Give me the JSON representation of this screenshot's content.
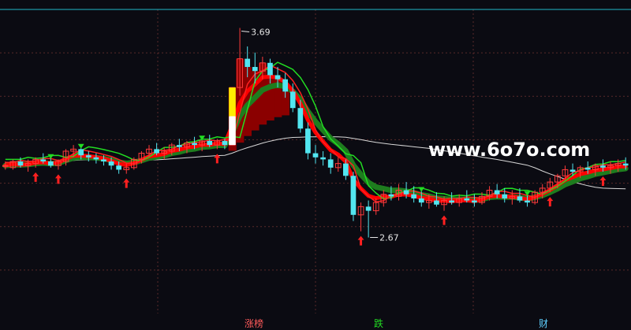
{
  "chart_data": {
    "type": "candlestick",
    "x": [
      1,
      2,
      3,
      4,
      5,
      6,
      7,
      8,
      9,
      10,
      11,
      12,
      13,
      14,
      15,
      16,
      17,
      18,
      19,
      20,
      21,
      22,
      23,
      24,
      25,
      26,
      27,
      28,
      29,
      30,
      31,
      32,
      33,
      34,
      35,
      36,
      37,
      38,
      39,
      40,
      41,
      42,
      43,
      44,
      45,
      46,
      47,
      48,
      49,
      50,
      51,
      52,
      53,
      54,
      55,
      56,
      57,
      58,
      59,
      60,
      61,
      62,
      63,
      64,
      65,
      66,
      67,
      68,
      69,
      70,
      71,
      72,
      73,
      74,
      75,
      76,
      77,
      78,
      79,
      80,
      81,
      82,
      83
    ],
    "ohlc": [
      [
        3.02,
        3.04,
        3.0,
        3.02
      ],
      [
        3.01,
        3.05,
        3.0,
        3.04
      ],
      [
        3.04,
        3.06,
        3.01,
        3.02
      ],
      [
        3.02,
        3.05,
        2.99,
        3.03
      ],
      [
        3.03,
        3.06,
        3.01,
        3.05
      ],
      [
        3.05,
        3.08,
        3.03,
        3.04
      ],
      [
        3.04,
        3.06,
        3.01,
        3.02
      ],
      [
        3.02,
        3.05,
        3.0,
        3.04
      ],
      [
        3.04,
        3.1,
        3.02,
        3.09
      ],
      [
        3.09,
        3.12,
        3.06,
        3.1
      ],
      [
        3.1,
        3.11,
        3.05,
        3.07
      ],
      [
        3.07,
        3.09,
        3.04,
        3.06
      ],
      [
        3.06,
        3.08,
        3.03,
        3.05
      ],
      [
        3.05,
        3.07,
        3.02,
        3.04
      ],
      [
        3.04,
        3.06,
        3.0,
        3.02
      ],
      [
        3.02,
        3.04,
        2.98,
        3.0
      ],
      [
        3.0,
        3.03,
        2.98,
        3.01
      ],
      [
        3.01,
        3.06,
        3.0,
        3.05
      ],
      [
        3.05,
        3.09,
        3.03,
        3.08
      ],
      [
        3.08,
        3.12,
        3.06,
        3.1
      ],
      [
        3.1,
        3.13,
        3.07,
        3.08
      ],
      [
        3.08,
        3.11,
        3.05,
        3.09
      ],
      [
        3.09,
        3.13,
        3.07,
        3.12
      ],
      [
        3.12,
        3.15,
        3.09,
        3.11
      ],
      [
        3.11,
        3.14,
        3.08,
        3.13
      ],
      [
        3.13,
        3.16,
        3.1,
        3.12
      ],
      [
        3.12,
        3.15,
        3.09,
        3.14
      ],
      [
        3.14,
        3.17,
        3.11,
        3.12
      ],
      [
        3.12,
        3.15,
        3.1,
        3.14
      ],
      [
        3.14,
        3.15,
        3.1,
        3.12
      ],
      [
        3.12,
        3.4,
        3.12,
        3.4
      ],
      [
        3.4,
        3.69,
        3.36,
        3.54
      ],
      [
        3.54,
        3.6,
        3.45,
        3.5
      ],
      [
        3.5,
        3.57,
        3.42,
        3.48
      ],
      [
        3.48,
        3.55,
        3.44,
        3.52
      ],
      [
        3.52,
        3.54,
        3.42,
        3.46
      ],
      [
        3.46,
        3.5,
        3.4,
        3.44
      ],
      [
        3.44,
        3.47,
        3.35,
        3.38
      ],
      [
        3.38,
        3.42,
        3.28,
        3.3
      ],
      [
        3.3,
        3.34,
        3.18,
        3.2
      ],
      [
        3.2,
        3.23,
        3.05,
        3.08
      ],
      [
        3.08,
        3.12,
        3.03,
        3.06
      ],
      [
        3.06,
        3.09,
        3.02,
        3.05
      ],
      [
        3.05,
        3.08,
        2.98,
        3.01
      ],
      [
        3.01,
        3.06,
        2.99,
        3.03
      ],
      [
        3.03,
        3.05,
        2.95,
        2.97
      ],
      [
        2.97,
        2.99,
        2.75,
        2.78
      ],
      [
        2.78,
        2.84,
        2.7,
        2.82
      ],
      [
        2.82,
        2.85,
        2.67,
        2.8
      ],
      [
        2.8,
        2.86,
        2.78,
        2.84
      ],
      [
        2.84,
        2.9,
        2.82,
        2.88
      ],
      [
        2.88,
        2.92,
        2.85,
        2.87
      ],
      [
        2.87,
        2.93,
        2.85,
        2.9
      ],
      [
        2.9,
        2.94,
        2.86,
        2.88
      ],
      [
        2.88,
        2.92,
        2.84,
        2.86
      ],
      [
        2.86,
        2.9,
        2.82,
        2.84
      ],
      [
        2.84,
        2.88,
        2.81,
        2.85
      ],
      [
        2.85,
        2.89,
        2.82,
        2.83
      ],
      [
        2.83,
        2.87,
        2.8,
        2.85
      ],
      [
        2.85,
        2.89,
        2.83,
        2.84
      ],
      [
        2.84,
        2.88,
        2.82,
        2.86
      ],
      [
        2.86,
        2.9,
        2.84,
        2.85
      ],
      [
        2.85,
        2.88,
        2.82,
        2.84
      ],
      [
        2.84,
        2.89,
        2.83,
        2.87
      ],
      [
        2.87,
        2.92,
        2.85,
        2.9
      ],
      [
        2.9,
        2.93,
        2.86,
        2.88
      ],
      [
        2.88,
        2.91,
        2.84,
        2.86
      ],
      [
        2.86,
        2.9,
        2.83,
        2.87
      ],
      [
        2.87,
        2.91,
        2.84,
        2.85
      ],
      [
        2.85,
        2.88,
        2.82,
        2.84
      ],
      [
        2.84,
        2.9,
        2.83,
        2.89
      ],
      [
        2.89,
        2.93,
        2.86,
        2.91
      ],
      [
        2.91,
        2.96,
        2.89,
        2.94
      ],
      [
        2.94,
        2.98,
        2.91,
        2.97
      ],
      [
        2.97,
        3.02,
        2.95,
        3.0
      ],
      [
        3.0,
        3.03,
        2.97,
        2.99
      ],
      [
        2.99,
        3.02,
        2.96,
        3.01
      ],
      [
        3.01,
        3.04,
        2.98,
        3.0
      ],
      [
        3.0,
        3.03,
        2.97,
        3.02
      ],
      [
        3.02,
        3.05,
        2.99,
        3.01
      ],
      [
        3.01,
        3.04,
        2.98,
        3.02
      ],
      [
        3.02,
        3.05,
        2.99,
        3.03
      ],
      [
        3.03,
        3.06,
        3.0,
        3.02
      ]
    ],
    "high_label": "3.69",
    "low_label": "2.67",
    "ylim": [
      2.3,
      3.78
    ],
    "grid": true,
    "watermark": "www.6o7o.com",
    "bottom_labels": [
      "涨榜",
      "跌",
      "财"
    ],
    "colors": {
      "up": "#ff3b3b",
      "down": "#52e6f0",
      "ma_long": "#d8d8d8",
      "ma_green": "#22dd22",
      "ma_red": "#ff2020",
      "band_green": "#1e7d1e",
      "band_red": "#ff0000",
      "volume_bar": "#8b0000",
      "top_line": "#20b8c8"
    }
  }
}
